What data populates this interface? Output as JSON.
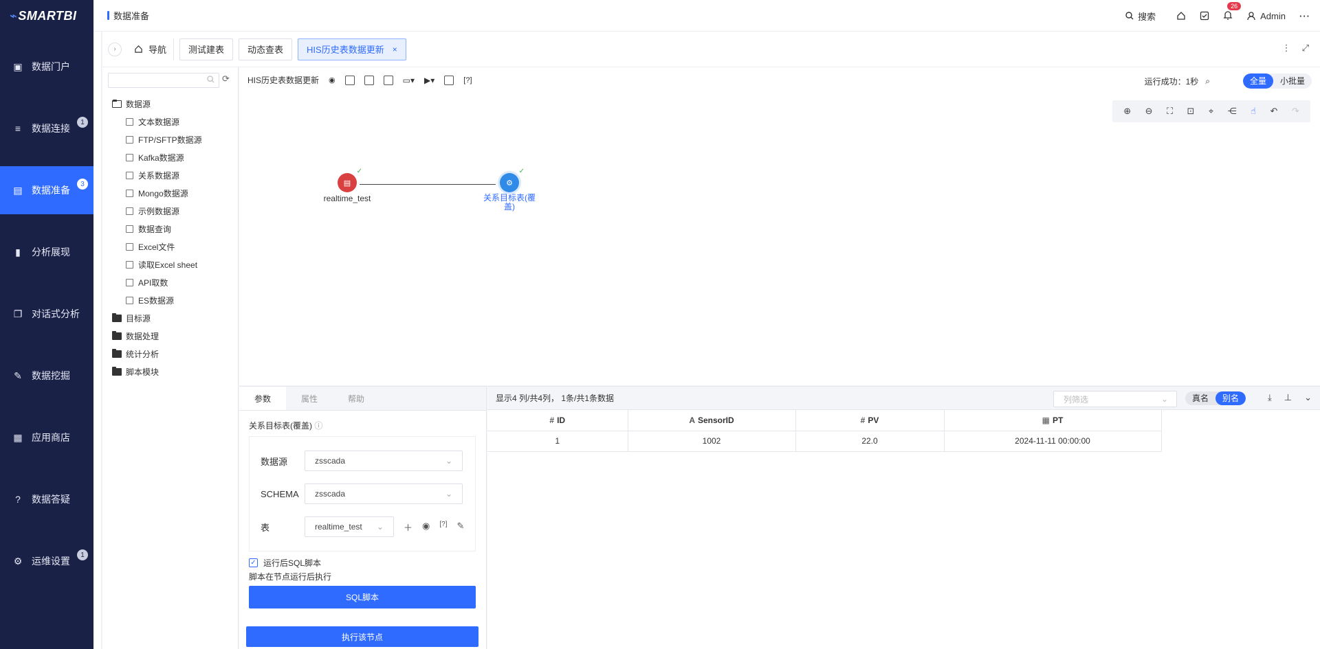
{
  "app": {
    "logo": "SMARTBI"
  },
  "sidebar": {
    "items": [
      {
        "label": "数据门户",
        "icon": "portal-icon",
        "badge": ""
      },
      {
        "label": "数据连接",
        "icon": "database-icon",
        "badge": "1"
      },
      {
        "label": "数据准备",
        "icon": "data-prep-icon",
        "badge": "3",
        "active": true
      },
      {
        "label": "分析展现",
        "icon": "bar-chart-icon",
        "badge": ""
      },
      {
        "label": "对话式分析",
        "icon": "chat-icon",
        "badge": ""
      },
      {
        "label": "数据挖掘",
        "icon": "mining-icon",
        "badge": ""
      },
      {
        "label": "应用商店",
        "icon": "store-icon",
        "badge": ""
      },
      {
        "label": "数据答疑",
        "icon": "help-icon",
        "badge": ""
      },
      {
        "label": "运维设置",
        "icon": "settings-icon",
        "badge": "1"
      }
    ]
  },
  "header": {
    "title": "数据准备",
    "search_label": "搜索",
    "notification_count": "26",
    "user": "Admin"
  },
  "tabs": {
    "nav_label": "导航",
    "items": [
      {
        "label": "测试建表",
        "active": false
      },
      {
        "label": "动态查表",
        "active": false
      },
      {
        "label": "HIS历史表数据更新",
        "active": true
      }
    ],
    "close_glyph": "×"
  },
  "tree": {
    "root": "数据源",
    "children": [
      "文本数据源",
      "FTP/SFTP数据源",
      "Kafka数据源",
      "关系数据源",
      "Mongo数据源",
      "示例数据源",
      "数据查询",
      "Excel文件",
      "读取Excel sheet",
      "API取数",
      "ES数据源"
    ],
    "folders": [
      "目标源",
      "数据处理",
      "统计分析",
      "脚本模块"
    ]
  },
  "canvas": {
    "flow_name": "HIS历史表数据更新",
    "run_status": "运行成功：1秒",
    "mode_full": "全量",
    "mode_batch": "小批量",
    "source_node": "realtime_test",
    "target_node": "关系目标表(覆盖)"
  },
  "params": {
    "tabs": [
      "参数",
      "属性",
      "帮助"
    ],
    "section_title": "关系目标表(覆盖)",
    "datasource_label": "数据源",
    "datasource_value": "zsscada",
    "schema_label": "SCHEMA",
    "schema_value": "zsscada",
    "table_label": "表",
    "table_value": "realtime_test",
    "checkbox_label": "运行后SQL脚本",
    "hint": "脚本在节点运行后执行",
    "sql_button": "SQL脚本",
    "execute_button": "执行该节点"
  },
  "data_panel": {
    "summary": "显示4 列/共4列， 1条/共1条数据",
    "filter_placeholder": "列筛选",
    "toggle_real": "真名",
    "toggle_alias": "别名",
    "columns": [
      {
        "name": "ID",
        "icon": "#"
      },
      {
        "name": "SensorID",
        "icon": "A"
      },
      {
        "name": "PV",
        "icon": "#"
      },
      {
        "name": "PT",
        "icon": "▦"
      }
    ],
    "rows": [
      [
        "1",
        "1002",
        "22.0",
        "2024-11-11 00:00:00"
      ]
    ]
  }
}
